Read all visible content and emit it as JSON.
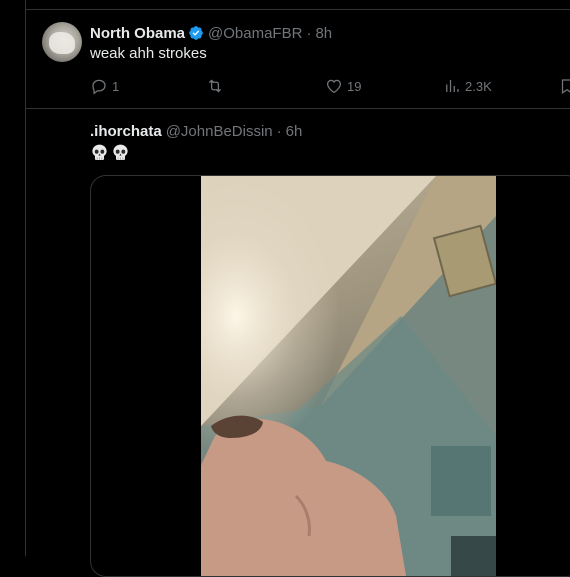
{
  "tweet1": {
    "display_name": "North Obama",
    "handle": "@ObamaFBR",
    "time": "8h",
    "text": "weak ahh strokes",
    "replies": "1",
    "likes": "19",
    "views": "2.3K",
    "avatar_icon": "avatar-image",
    "verified_color": "#1d9bf0"
  },
  "tweet2": {
    "display_name": ".ihorchata",
    "handle": "@JohnBeDissin",
    "time": "6h",
    "emoji_icon": "skull-emoji",
    "media": "video-thumbnail"
  },
  "theme": {
    "background": "#000000",
    "text_primary": "#e7e9ea",
    "text_secondary": "#71767b",
    "border": "#2f3336",
    "accent": "#1d9bf0"
  }
}
